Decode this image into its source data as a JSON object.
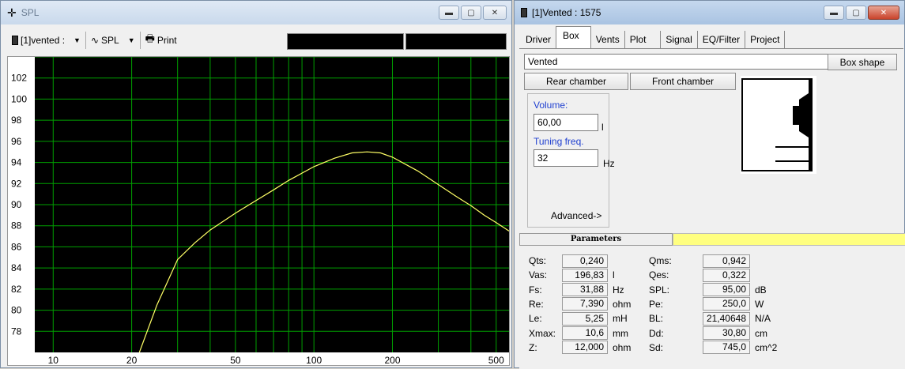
{
  "spl_window": {
    "title": "SPL",
    "toolbar": {
      "project_select": "[1]vented :",
      "curve_select": "SPL",
      "print_label": "Print"
    }
  },
  "chart_data": {
    "type": "line",
    "x_scale": "log",
    "xlim": [
      8.5,
      560
    ],
    "ylim": [
      76,
      104
    ],
    "x_ticks": [
      10,
      20,
      50,
      100,
      200,
      500
    ],
    "y_ticks": [
      78,
      80,
      82,
      84,
      86,
      88,
      90,
      92,
      94,
      96,
      98,
      100,
      102
    ],
    "grid": true,
    "background": "#000000",
    "grid_color": "#00a000",
    "line_color": "#ffff66",
    "series": [
      {
        "x": [
          21.4,
          25,
          30,
          35,
          40,
          50,
          60,
          70,
          80,
          100,
          120,
          140,
          160,
          180,
          200,
          250,
          300,
          350,
          400,
          450,
          500,
          560
        ],
        "y": [
          76.0,
          80.5,
          84.8,
          86.4,
          87.6,
          89.2,
          90.4,
          91.4,
          92.3,
          93.6,
          94.4,
          94.9,
          95.0,
          94.9,
          94.5,
          93.2,
          91.9,
          90.8,
          89.9,
          89.0,
          88.3,
          87.5
        ]
      }
    ]
  },
  "vented_window": {
    "title": "[1]Vented : 1575",
    "tabs": [
      "Driver",
      "Box",
      "Vents",
      "Plot",
      "Signal",
      "EQ/Filter",
      "Project"
    ],
    "box_type": "Vented",
    "box_shape_btn": "Box shape",
    "rear_chamber_btn": "Rear chamber",
    "front_chamber_btn": "Front chamber",
    "volume_label": "Volume:",
    "volume_value": "60,00",
    "volume_unit": "l",
    "tuning_label": "Tuning freq.",
    "tuning_value": "32",
    "tuning_unit": "Hz",
    "advanced_label": "Advanced->",
    "params_header": "Parameters",
    "params_left": [
      {
        "label": "Qts:",
        "value": "0,240",
        "unit": ""
      },
      {
        "label": "Vas:",
        "value": "196,83",
        "unit": "l"
      },
      {
        "label": "Fs:",
        "value": "31,88",
        "unit": "Hz"
      },
      {
        "label": "Re:",
        "value": "7,390",
        "unit": "ohm"
      },
      {
        "label": "Le:",
        "value": "5,25",
        "unit": "mH"
      },
      {
        "label": "Xmax:",
        "value": "10,6",
        "unit": "mm"
      },
      {
        "label": "Z:",
        "value": "12,000",
        "unit": "ohm"
      }
    ],
    "params_right": [
      {
        "label": "Qms:",
        "value": "0,942",
        "unit": ""
      },
      {
        "label": "Qes:",
        "value": "0,322",
        "unit": ""
      },
      {
        "label": "SPL:",
        "value": "95,00",
        "unit": "dB"
      },
      {
        "label": "Pe:",
        "value": "250,0",
        "unit": "W"
      },
      {
        "label": "BL:",
        "value": "21,40648",
        "unit": "N/A"
      },
      {
        "label": "Dd:",
        "value": "30,80",
        "unit": "cm"
      },
      {
        "label": "Sd:",
        "value": "745,0",
        "unit": "cm^2"
      }
    ]
  }
}
